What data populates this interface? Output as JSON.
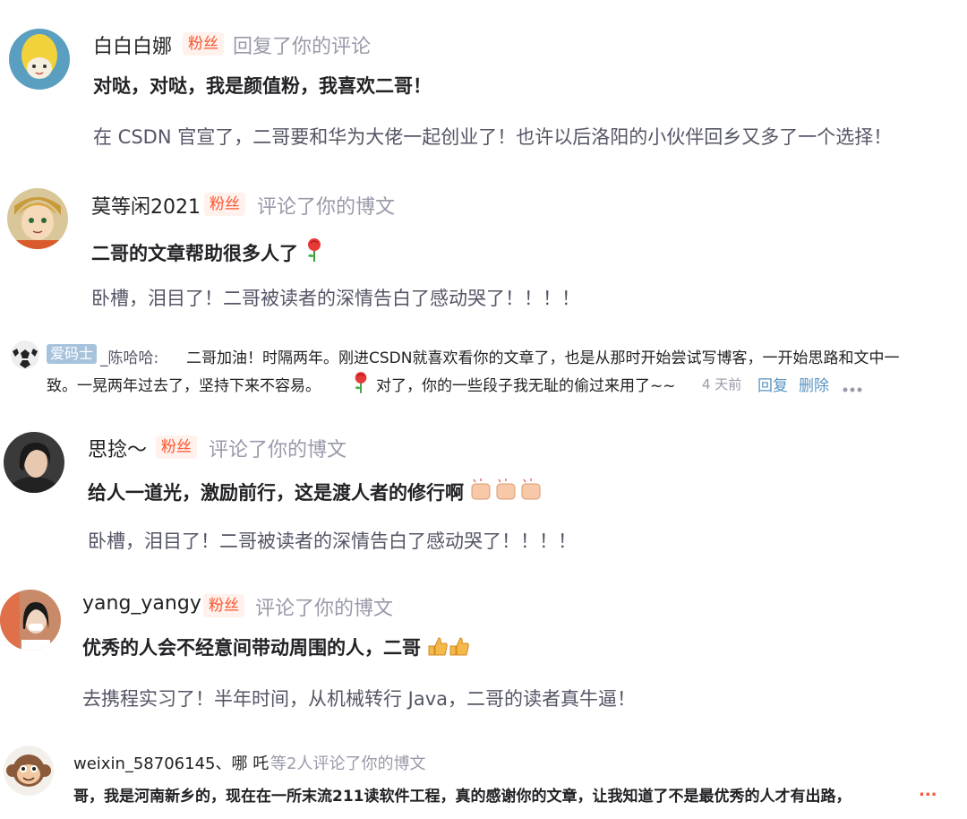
{
  "notifications": [
    {
      "user": "白白白娜",
      "badge": "粉丝",
      "action": "回复了你的评论",
      "reply": "对哒，对哒，我是颜值粉，我喜欢二哥！",
      "original": "在 CSDN 官宣了，二哥要和华为大佬一起创业了！也许以后洛阳的小伙伴回乡又多了一个选择！",
      "avatar_icon": "lemon-cat-avatar"
    },
    {
      "user": "莫等闲2021",
      "badge": "粉丝",
      "action": "评论了你的博文",
      "reply": "二哥的文章帮助很多人了",
      "original": "卧槽，泪目了！二哥被读者的深情告白了感动哭了！！！！",
      "avatar_icon": "anime-boy-avatar",
      "reply_emoji": "rose-icon"
    },
    {
      "badge": "爱码士",
      "user": "_陈哈哈:",
      "line1": "二哥加油！时隔两年。刚进CSDN就喜欢看你的文章了，也是从那时开始尝试写博客，一开始思路和文中一",
      "line2a": "致。一晃两年过去了，坚持下来不容易。",
      "line2b": "对了，你的一些段子我无耻的偷过来用了~~",
      "time": "4 天前",
      "reply_label": "回复",
      "delete_label": "删除",
      "more_icon": "more-dots-icon",
      "avatar_icon": "soccer-ball-avatar"
    },
    {
      "user": "思捻～",
      "badge": "粉丝",
      "action": "评论了你的博文",
      "reply": "给人一道光，激励前行，这是渡人者的修行啊",
      "original": "卧槽，泪目了！二哥被读者的深情告白了感动哭了！！！！",
      "avatar_icon": "girl-photo-avatar",
      "reply_emoji": "clap-icon"
    },
    {
      "user": "yang_yangy",
      "badge": "粉丝",
      "action": "评论了你的博文",
      "reply": "优秀的人会不经意间带动周围的人，二哥",
      "original": "去携程实习了！半年时间，从机械转行 Java，二哥的读者真牛逼！",
      "avatar_icon": "woman-photo-avatar",
      "reply_emoji": "thumbs-up-icon"
    },
    {
      "user": "weixin_58706145、哪 吒",
      "action": "等2人评论了你的博文",
      "reply": "哥，我是河南新乡的，现在在一所末流211读软件工程，真的感谢你的文章，让我知道了不是最优秀的人才有出路，",
      "ellipsis": "...",
      "avatar_icon": "monkey-avatar"
    }
  ],
  "colors": {
    "badge_text": "#fc5531",
    "badge_bg": "#fff1ec",
    "muted": "#999aaa",
    "link": "#5893c2"
  }
}
